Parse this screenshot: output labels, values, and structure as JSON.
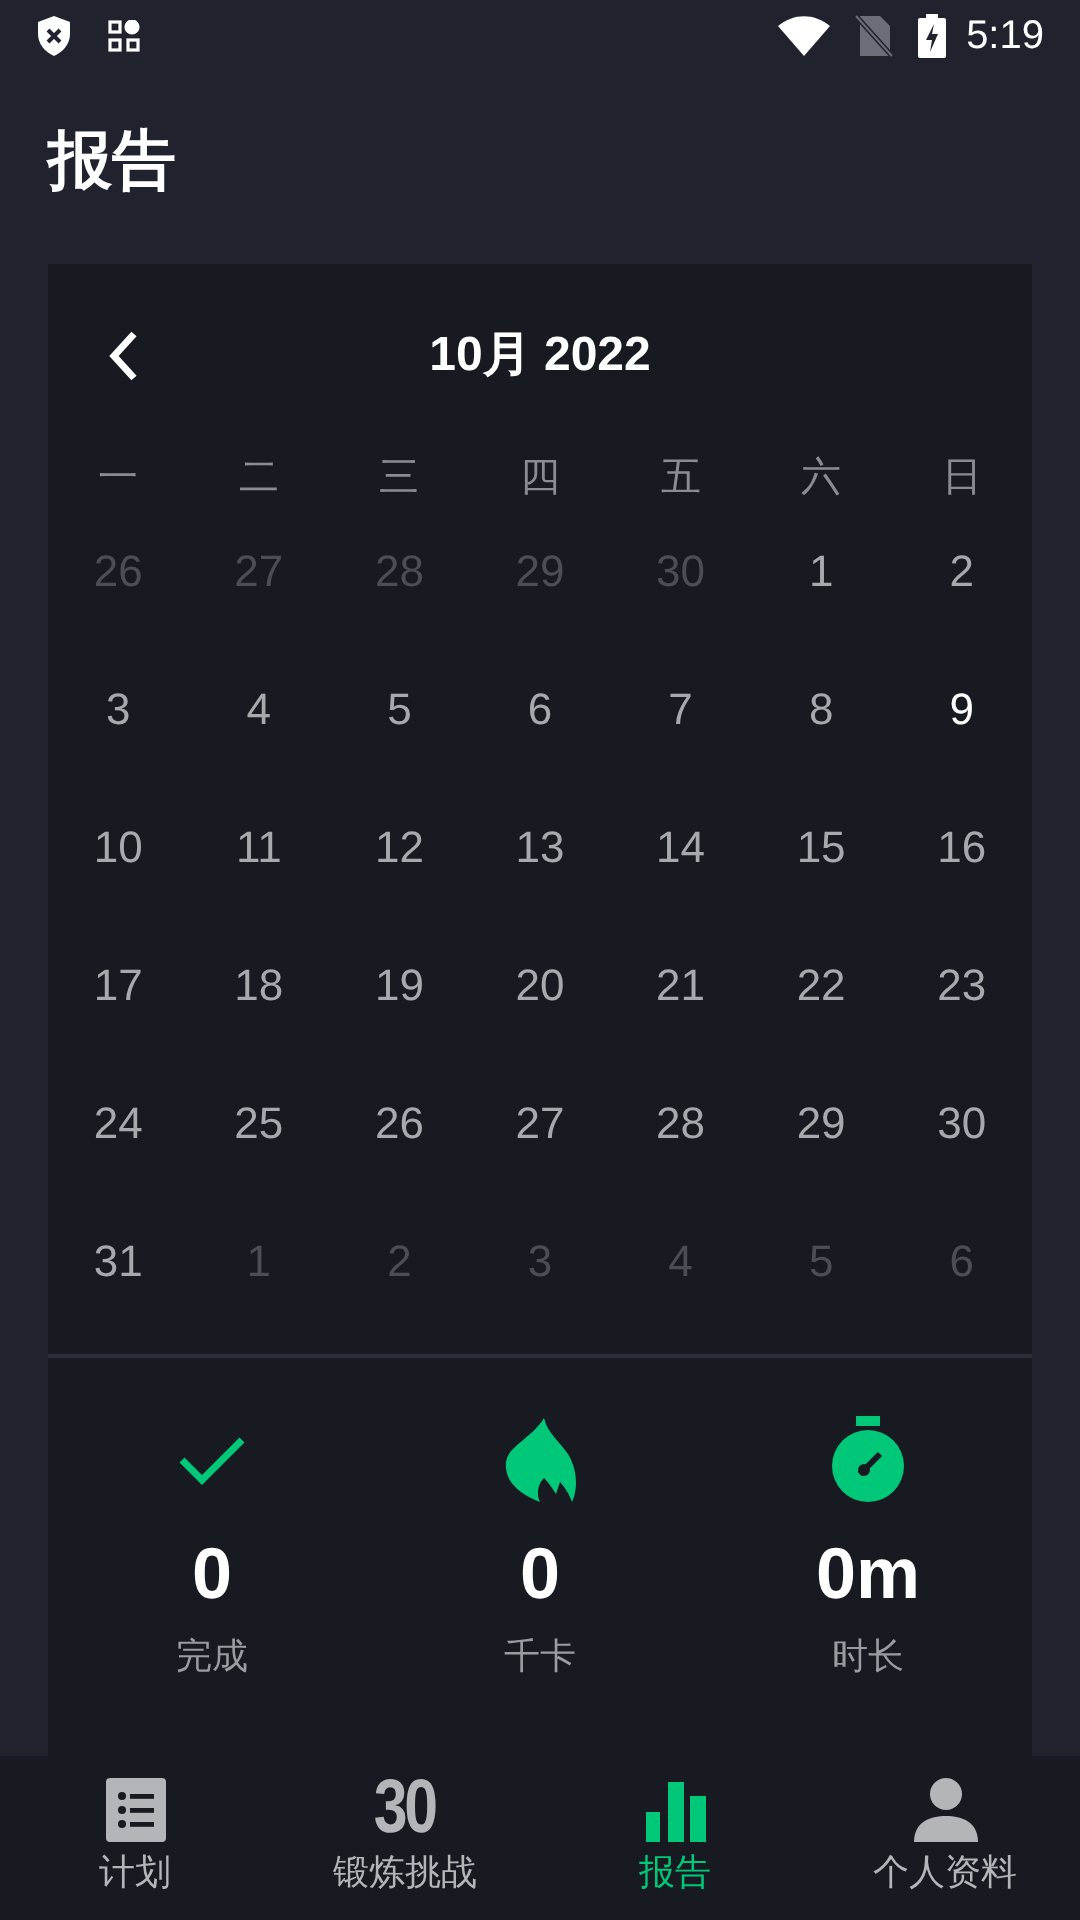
{
  "status_bar": {
    "time": "5:19"
  },
  "title": "报告",
  "calendar": {
    "month_label": "10月 2022",
    "weekdays": [
      "一",
      "二",
      "三",
      "四",
      "五",
      "六",
      "日"
    ],
    "days": [
      {
        "label": "26",
        "kind": "outside"
      },
      {
        "label": "27",
        "kind": "outside"
      },
      {
        "label": "28",
        "kind": "outside"
      },
      {
        "label": "29",
        "kind": "outside"
      },
      {
        "label": "30",
        "kind": "outside"
      },
      {
        "label": "1",
        "kind": "normal"
      },
      {
        "label": "2",
        "kind": "normal"
      },
      {
        "label": "3",
        "kind": "normal"
      },
      {
        "label": "4",
        "kind": "normal"
      },
      {
        "label": "5",
        "kind": "normal"
      },
      {
        "label": "6",
        "kind": "normal"
      },
      {
        "label": "7",
        "kind": "normal"
      },
      {
        "label": "8",
        "kind": "normal"
      },
      {
        "label": "9",
        "kind": "today"
      },
      {
        "label": "10",
        "kind": "normal"
      },
      {
        "label": "11",
        "kind": "normal"
      },
      {
        "label": "12",
        "kind": "normal"
      },
      {
        "label": "13",
        "kind": "normal"
      },
      {
        "label": "14",
        "kind": "normal"
      },
      {
        "label": "15",
        "kind": "normal"
      },
      {
        "label": "16",
        "kind": "normal"
      },
      {
        "label": "17",
        "kind": "normal"
      },
      {
        "label": "18",
        "kind": "normal"
      },
      {
        "label": "19",
        "kind": "normal"
      },
      {
        "label": "20",
        "kind": "normal"
      },
      {
        "label": "21",
        "kind": "normal"
      },
      {
        "label": "22",
        "kind": "normal"
      },
      {
        "label": "23",
        "kind": "normal"
      },
      {
        "label": "24",
        "kind": "normal"
      },
      {
        "label": "25",
        "kind": "normal"
      },
      {
        "label": "26",
        "kind": "normal"
      },
      {
        "label": "27",
        "kind": "normal"
      },
      {
        "label": "28",
        "kind": "normal"
      },
      {
        "label": "29",
        "kind": "normal"
      },
      {
        "label": "30",
        "kind": "normal"
      },
      {
        "label": "31",
        "kind": "normal"
      },
      {
        "label": "1",
        "kind": "outside"
      },
      {
        "label": "2",
        "kind": "outside"
      },
      {
        "label": "3",
        "kind": "outside"
      },
      {
        "label": "4",
        "kind": "outside"
      },
      {
        "label": "5",
        "kind": "outside"
      },
      {
        "label": "6",
        "kind": "outside"
      }
    ]
  },
  "stats": [
    {
      "kind": "check",
      "value": "0",
      "label": "完成"
    },
    {
      "kind": "flame",
      "value": "0",
      "label": "千卡"
    },
    {
      "kind": "timer",
      "value": "0m",
      "label": "时长"
    }
  ],
  "nav": [
    {
      "kind": "list",
      "label": "计划",
      "selected": false
    },
    {
      "kind": "number",
      "icon_text": "30",
      "label": "锻炼挑战",
      "selected": false
    },
    {
      "kind": "chart",
      "label": "报告",
      "selected": true
    },
    {
      "kind": "person",
      "label": "个人资料",
      "selected": false
    }
  ]
}
